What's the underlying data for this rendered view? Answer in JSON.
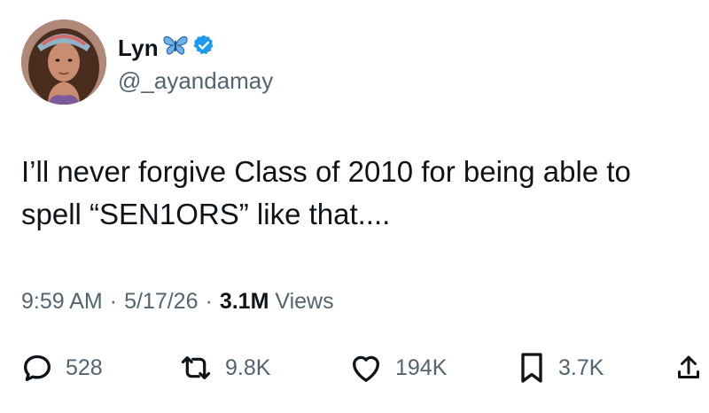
{
  "tweet": {
    "author": {
      "display_name": "Lyn",
      "name_emoji": "butterfly-icon",
      "verified": true,
      "handle": "@_ayandamay"
    },
    "text": "I’ll never forgive Class of 2010 for being able to spell “SEN1ORS” like that....",
    "meta": {
      "time": "9:59 AM",
      "separator": "·",
      "date": "5/17/26",
      "views_count": "3.1M",
      "views_label": "Views"
    },
    "actions": {
      "replies": "528",
      "reposts": "9.8K",
      "likes": "194K",
      "bookmarks": "3.7K"
    }
  },
  "colors": {
    "verified_blue": "#1d9bf0",
    "secondary_text": "#536471",
    "primary_text": "#0f1419"
  }
}
